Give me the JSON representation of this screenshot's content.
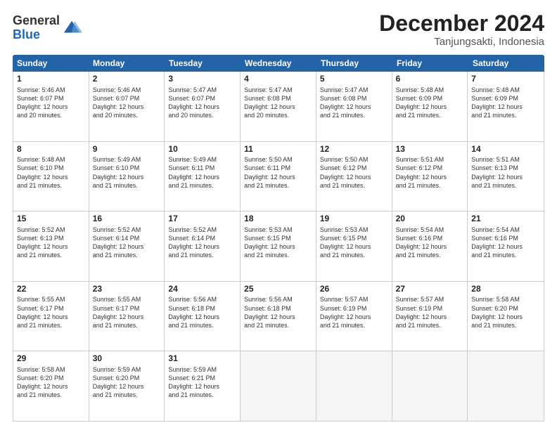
{
  "logo": {
    "general": "General",
    "blue": "Blue"
  },
  "header": {
    "month": "December 2024",
    "location": "Tanjungsakti, Indonesia"
  },
  "weekdays": [
    "Sunday",
    "Monday",
    "Tuesday",
    "Wednesday",
    "Thursday",
    "Friday",
    "Saturday"
  ],
  "weeks": [
    [
      {
        "day": "1",
        "text": "Sunrise: 5:46 AM\nSunset: 6:07 PM\nDaylight: 12 hours\nand 20 minutes."
      },
      {
        "day": "2",
        "text": "Sunrise: 5:46 AM\nSunset: 6:07 PM\nDaylight: 12 hours\nand 20 minutes."
      },
      {
        "day": "3",
        "text": "Sunrise: 5:47 AM\nSunset: 6:07 PM\nDaylight: 12 hours\nand 20 minutes."
      },
      {
        "day": "4",
        "text": "Sunrise: 5:47 AM\nSunset: 6:08 PM\nDaylight: 12 hours\nand 20 minutes."
      },
      {
        "day": "5",
        "text": "Sunrise: 5:47 AM\nSunset: 6:08 PM\nDaylight: 12 hours\nand 21 minutes."
      },
      {
        "day": "6",
        "text": "Sunrise: 5:48 AM\nSunset: 6:09 PM\nDaylight: 12 hours\nand 21 minutes."
      },
      {
        "day": "7",
        "text": "Sunrise: 5:48 AM\nSunset: 6:09 PM\nDaylight: 12 hours\nand 21 minutes."
      }
    ],
    [
      {
        "day": "8",
        "text": "Sunrise: 5:48 AM\nSunset: 6:10 PM\nDaylight: 12 hours\nand 21 minutes."
      },
      {
        "day": "9",
        "text": "Sunrise: 5:49 AM\nSunset: 6:10 PM\nDaylight: 12 hours\nand 21 minutes."
      },
      {
        "day": "10",
        "text": "Sunrise: 5:49 AM\nSunset: 6:11 PM\nDaylight: 12 hours\nand 21 minutes."
      },
      {
        "day": "11",
        "text": "Sunrise: 5:50 AM\nSunset: 6:11 PM\nDaylight: 12 hours\nand 21 minutes."
      },
      {
        "day": "12",
        "text": "Sunrise: 5:50 AM\nSunset: 6:12 PM\nDaylight: 12 hours\nand 21 minutes."
      },
      {
        "day": "13",
        "text": "Sunrise: 5:51 AM\nSunset: 6:12 PM\nDaylight: 12 hours\nand 21 minutes."
      },
      {
        "day": "14",
        "text": "Sunrise: 5:51 AM\nSunset: 6:13 PM\nDaylight: 12 hours\nand 21 minutes."
      }
    ],
    [
      {
        "day": "15",
        "text": "Sunrise: 5:52 AM\nSunset: 6:13 PM\nDaylight: 12 hours\nand 21 minutes."
      },
      {
        "day": "16",
        "text": "Sunrise: 5:52 AM\nSunset: 6:14 PM\nDaylight: 12 hours\nand 21 minutes."
      },
      {
        "day": "17",
        "text": "Sunrise: 5:52 AM\nSunset: 6:14 PM\nDaylight: 12 hours\nand 21 minutes."
      },
      {
        "day": "18",
        "text": "Sunrise: 5:53 AM\nSunset: 6:15 PM\nDaylight: 12 hours\nand 21 minutes."
      },
      {
        "day": "19",
        "text": "Sunrise: 5:53 AM\nSunset: 6:15 PM\nDaylight: 12 hours\nand 21 minutes."
      },
      {
        "day": "20",
        "text": "Sunrise: 5:54 AM\nSunset: 6:16 PM\nDaylight: 12 hours\nand 21 minutes."
      },
      {
        "day": "21",
        "text": "Sunrise: 5:54 AM\nSunset: 6:16 PM\nDaylight: 12 hours\nand 21 minutes."
      }
    ],
    [
      {
        "day": "22",
        "text": "Sunrise: 5:55 AM\nSunset: 6:17 PM\nDaylight: 12 hours\nand 21 minutes."
      },
      {
        "day": "23",
        "text": "Sunrise: 5:55 AM\nSunset: 6:17 PM\nDaylight: 12 hours\nand 21 minutes."
      },
      {
        "day": "24",
        "text": "Sunrise: 5:56 AM\nSunset: 6:18 PM\nDaylight: 12 hours\nand 21 minutes."
      },
      {
        "day": "25",
        "text": "Sunrise: 5:56 AM\nSunset: 6:18 PM\nDaylight: 12 hours\nand 21 minutes."
      },
      {
        "day": "26",
        "text": "Sunrise: 5:57 AM\nSunset: 6:19 PM\nDaylight: 12 hours\nand 21 minutes."
      },
      {
        "day": "27",
        "text": "Sunrise: 5:57 AM\nSunset: 6:19 PM\nDaylight: 12 hours\nand 21 minutes."
      },
      {
        "day": "28",
        "text": "Sunrise: 5:58 AM\nSunset: 6:20 PM\nDaylight: 12 hours\nand 21 minutes."
      }
    ],
    [
      {
        "day": "29",
        "text": "Sunrise: 5:58 AM\nSunset: 6:20 PM\nDaylight: 12 hours\nand 21 minutes."
      },
      {
        "day": "30",
        "text": "Sunrise: 5:59 AM\nSunset: 6:20 PM\nDaylight: 12 hours\nand 21 minutes."
      },
      {
        "day": "31",
        "text": "Sunrise: 5:59 AM\nSunset: 6:21 PM\nDaylight: 12 hours\nand 21 minutes."
      },
      {
        "day": "",
        "text": ""
      },
      {
        "day": "",
        "text": ""
      },
      {
        "day": "",
        "text": ""
      },
      {
        "day": "",
        "text": ""
      }
    ]
  ]
}
